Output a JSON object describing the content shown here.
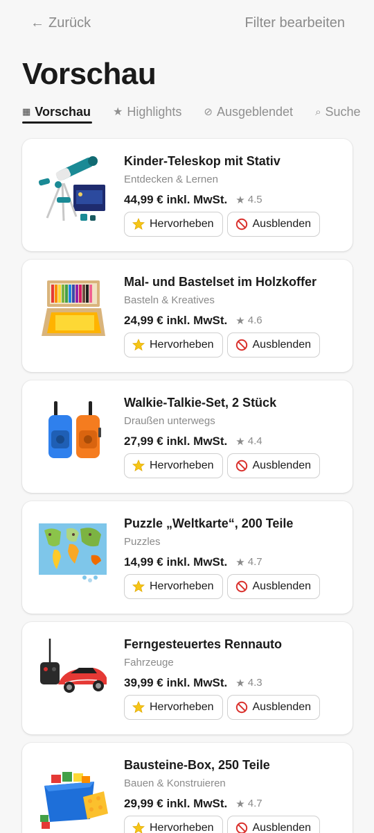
{
  "nav": {
    "back_label": "Zurück",
    "filter_label": "Filter bearbeiten"
  },
  "page": {
    "title": "Vorschau"
  },
  "tabs": [
    {
      "label": "Vorschau",
      "icon": "grid-icon",
      "active": true
    },
    {
      "label": "Highlights",
      "icon": "star-icon",
      "active": false
    },
    {
      "label": "Ausgeblendet",
      "icon": "hidden-icon",
      "active": false
    },
    {
      "label": "Suche",
      "icon": "search-icon",
      "active": false
    }
  ],
  "actions": {
    "highlight_label": "Hervorheben",
    "hide_label": "Ausblenden"
  },
  "colors": {
    "highlight_star": "#f5c518",
    "hide_red": "#d9302c",
    "active_tab": "#1a1a1a"
  },
  "products": [
    {
      "name": "Kinder-Teleskop mit Stativ",
      "category": "Entdecken & Lernen",
      "price": "44,99 € inkl. MwSt.",
      "rating": "4.5",
      "image": "telescope-image"
    },
    {
      "name": "Mal- und Bastelset im Holzkoffer",
      "category": "Basteln & Kreatives",
      "price": "24,99 € inkl. MwSt.",
      "rating": "4.6",
      "image": "art-set-image"
    },
    {
      "name": "Walkie-Talkie-Set, 2 Stück",
      "category": "Draußen unterwegs",
      "price": "27,99 € inkl. MwSt.",
      "rating": "4.4",
      "image": "walkie-talkie-image"
    },
    {
      "name": "Puzzle „Weltkarte“, 200 Teile",
      "category": "Puzzles",
      "price": "14,99 € inkl. MwSt.",
      "rating": "4.7",
      "image": "world-puzzle-image"
    },
    {
      "name": "Ferngesteuertes Rennauto",
      "category": "Fahrzeuge",
      "price": "39,99 € inkl. MwSt.",
      "rating": "4.3",
      "image": "rc-car-image"
    },
    {
      "name": "Bausteine-Box, 250 Teile",
      "category": "Bauen & Konstruieren",
      "price": "29,99 € inkl. MwSt.",
      "rating": "4.7",
      "image": "building-blocks-image"
    }
  ]
}
